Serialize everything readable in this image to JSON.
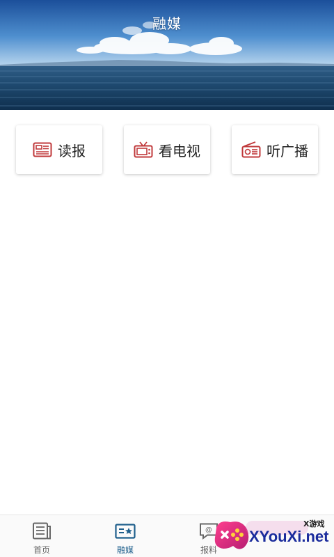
{
  "header": {
    "title": "融媒"
  },
  "services": [
    {
      "label": "读报",
      "icon": "newspaper-icon"
    },
    {
      "label": "看电视",
      "icon": "tv-icon"
    },
    {
      "label": "听广播",
      "icon": "radio-icon"
    }
  ],
  "tabbar": {
    "tabs": [
      {
        "label": "首页",
        "icon": "home-document-icon",
        "active": false
      },
      {
        "label": "融媒",
        "icon": "media-star-icon",
        "active": true
      },
      {
        "label": "报料",
        "icon": "report-chat-icon",
        "active": false
      },
      {
        "label": "",
        "icon": "",
        "active": false
      }
    ]
  },
  "watermark": {
    "small_text": "X游戏",
    "big_text": "XYouXi.net"
  },
  "colors": {
    "accent": "#1e5f8c",
    "icon_red": "#c0393b",
    "tab_inactive": "#666666"
  }
}
